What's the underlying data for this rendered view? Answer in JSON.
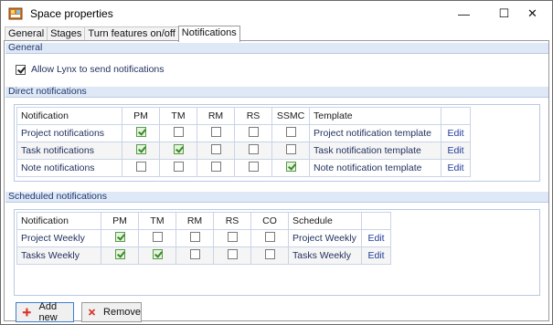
{
  "window": {
    "title": "Space properties",
    "minimize_glyph": "—",
    "maximize_glyph": "☐",
    "close_glyph": "✕"
  },
  "tabs": [
    {
      "label": "General",
      "active": false
    },
    {
      "label": "Stages",
      "active": false
    },
    {
      "label": "Turn features on/off",
      "active": false
    },
    {
      "label": "Notifications",
      "active": true
    }
  ],
  "general": {
    "header": "General",
    "allow_label": "Allow Lynx to send notifications",
    "allow_checked": true
  },
  "direct": {
    "header": "Direct notifications",
    "columns": [
      "Notification",
      "PM",
      "TM",
      "RM",
      "RS",
      "SSMC",
      "Template",
      ""
    ],
    "rows": [
      {
        "name": "Project notifications",
        "checks": [
          true,
          false,
          false,
          false,
          false
        ],
        "template": "Project notification template",
        "action": "Edit"
      },
      {
        "name": "Task notifications",
        "checks": [
          true,
          true,
          false,
          false,
          false
        ],
        "template": "Task notification template",
        "action": "Edit"
      },
      {
        "name": "Note notifications",
        "checks": [
          false,
          false,
          false,
          false,
          true
        ],
        "template": "Note notification template",
        "action": "Edit"
      }
    ]
  },
  "scheduled": {
    "header": "Scheduled notifications",
    "columns": [
      "Notification",
      "PM",
      "TM",
      "RM",
      "RS",
      "CO",
      "Schedule",
      ""
    ],
    "rows": [
      {
        "name": "Project Weekly",
        "checks": [
          true,
          false,
          false,
          false,
          false
        ],
        "schedule": "Project Weekly",
        "action": "Edit"
      },
      {
        "name": "Tasks Weekly",
        "checks": [
          true,
          true,
          false,
          false,
          false
        ],
        "schedule": "Tasks Weekly",
        "action": "Edit"
      }
    ]
  },
  "buttons": {
    "add_label": "Add new",
    "remove_label": "Remove"
  },
  "colors": {
    "section_header_bg": "#dfe8f6",
    "add_icon": "#d9342b",
    "remove_icon": "#d9342b",
    "check_green": "#3a8a2a"
  },
  "icons": {
    "app": "space-properties-app-icon",
    "add": "plus-icon",
    "remove": "x-icon"
  }
}
